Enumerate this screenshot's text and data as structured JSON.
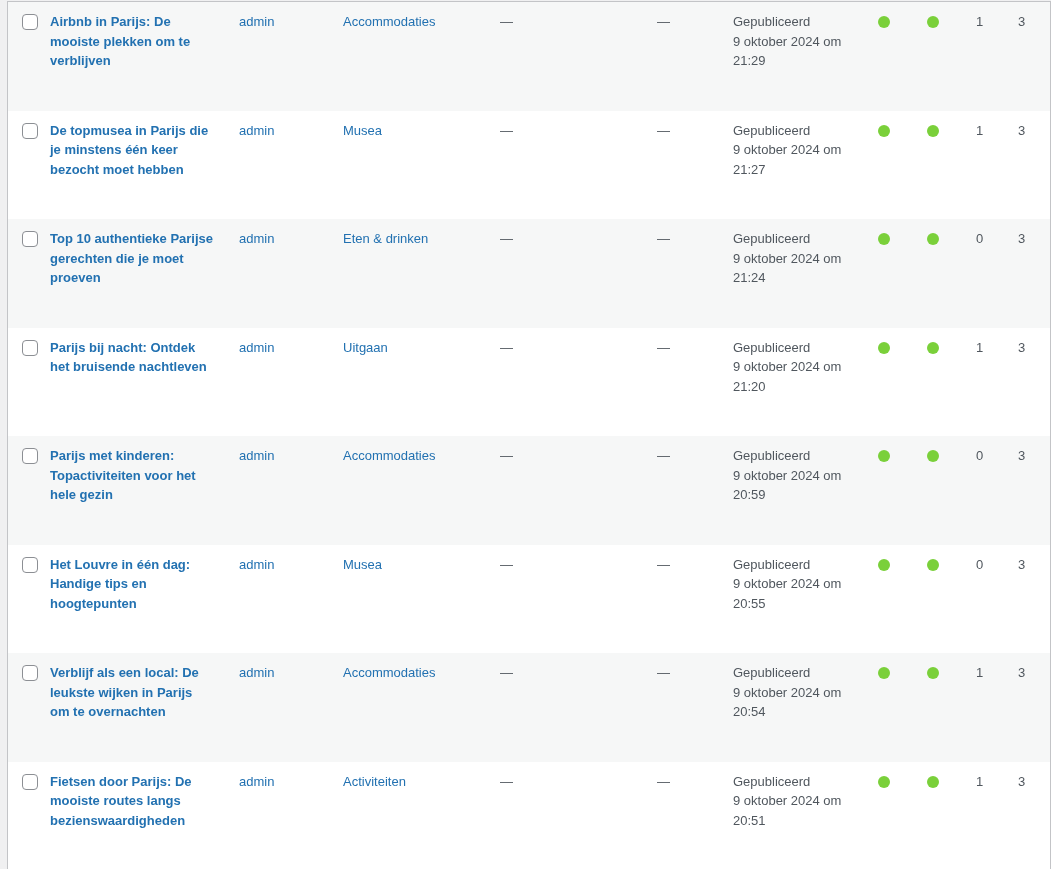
{
  "posts": [
    {
      "title": "Airbnb in Parijs: De mooiste plekken om te verblijven",
      "author": "admin",
      "category": "Accommodaties",
      "tags": "—",
      "column_5": "—",
      "status": "Gepubliceerd",
      "date": "9 oktober 2024 om 21:29",
      "seo_score": {
        "color": "#7ad03a"
      },
      "readability_score": {
        "color": "#7ad03a"
      },
      "column_8": "1",
      "column_9": "3",
      "checked": false
    },
    {
      "title": "De topmusea in Parijs die je minstens één keer bezocht moet hebben",
      "author": "admin",
      "category": "Musea",
      "tags": "—",
      "column_5": "—",
      "status": "Gepubliceerd",
      "date": "9 oktober 2024 om 21:27",
      "seo_score": {
        "color": "#7ad03a"
      },
      "readability_score": {
        "color": "#7ad03a"
      },
      "column_8": "1",
      "column_9": "3",
      "checked": false
    },
    {
      "title": "Top 10 authentieke Parijse gerechten die je moet proeven",
      "author": "admin",
      "category": "Eten & drinken",
      "tags": "—",
      "column_5": "—",
      "status": "Gepubliceerd",
      "date": "9 oktober 2024 om 21:24",
      "seo_score": {
        "color": "#7ad03a"
      },
      "readability_score": {
        "color": "#7ad03a"
      },
      "column_8": "0",
      "column_9": "3",
      "checked": false
    },
    {
      "title": "Parijs bij nacht: Ontdek het bruisende nachtleven",
      "author": "admin",
      "category": "Uitgaan",
      "tags": "—",
      "column_5": "—",
      "status": "Gepubliceerd",
      "date": "9 oktober 2024 om 21:20",
      "seo_score": {
        "color": "#7ad03a"
      },
      "readability_score": {
        "color": "#7ad03a"
      },
      "column_8": "1",
      "column_9": "3",
      "checked": false
    },
    {
      "title": "Parijs met kinderen: Topactiviteiten voor het hele gezin",
      "author": "admin",
      "category": "Accommodaties",
      "tags": "—",
      "column_5": "—",
      "status": "Gepubliceerd",
      "date": "9 oktober 2024 om 20:59",
      "seo_score": {
        "color": "#7ad03a"
      },
      "readability_score": {
        "color": "#7ad03a"
      },
      "column_8": "0",
      "column_9": "3",
      "checked": false
    },
    {
      "title": "Het Louvre in één dag: Handige tips en hoogtepunten",
      "author": "admin",
      "category": "Musea",
      "tags": "—",
      "column_5": "—",
      "status": "Gepubliceerd",
      "date": "9 oktober 2024 om 20:55",
      "seo_score": {
        "color": "#7ad03a"
      },
      "readability_score": {
        "color": "#7ad03a"
      },
      "column_8": "0",
      "column_9": "3",
      "checked": false
    },
    {
      "title": "Verblijf als een local: De leukste wijken in Parijs om te overnachten",
      "author": "admin",
      "category": "Accommodaties",
      "tags": "—",
      "column_5": "—",
      "status": "Gepubliceerd",
      "date": "9 oktober 2024 om 20:54",
      "seo_score": {
        "color": "#7ad03a"
      },
      "readability_score": {
        "color": "#7ad03a"
      },
      "column_8": "1",
      "column_9": "3",
      "checked": false
    },
    {
      "title": "Fietsen door Parijs: De mooiste routes langs bezienswaardigheden",
      "author": "admin",
      "category": "Activiteiten",
      "tags": "—",
      "column_5": "—",
      "status": "Gepubliceerd",
      "date": "9 oktober 2024 om 20:51",
      "seo_score": {
        "color": "#7ad03a"
      },
      "readability_score": {
        "color": "#7ad03a"
      },
      "column_8": "1",
      "column_9": "3",
      "checked": false
    }
  ]
}
